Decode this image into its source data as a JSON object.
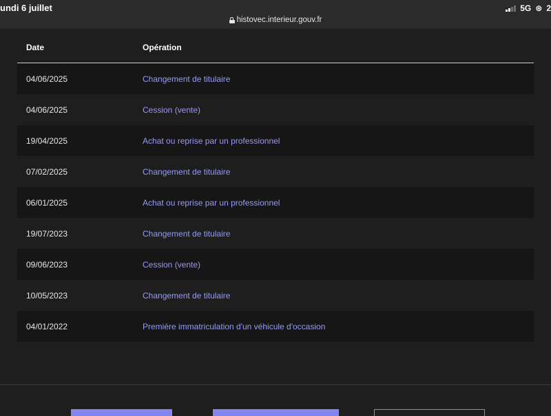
{
  "status_bar": {
    "time_text": "undi 6 juillet",
    "network": "5G",
    "right_trailing": "2"
  },
  "browser": {
    "url": "histovec.interieur.gouv.fr"
  },
  "table": {
    "headers": {
      "date": "Date",
      "operation": "Opération"
    },
    "rows": [
      {
        "date": "04/06/2025",
        "operation": "Changement de titulaire"
      },
      {
        "date": "04/06/2025",
        "operation": "Cession (vente)"
      },
      {
        "date": "19/04/2025",
        "operation": "Achat ou reprise par un professionnel"
      },
      {
        "date": "07/02/2025",
        "operation": "Changement de titulaire"
      },
      {
        "date": "06/01/2025",
        "operation": "Achat ou reprise par un professionnel"
      },
      {
        "date": "19/07/2023",
        "operation": "Changement de titulaire"
      },
      {
        "date": "09/06/2023",
        "operation": "Cession (vente)"
      },
      {
        "date": "10/05/2023",
        "operation": "Changement de titulaire"
      },
      {
        "date": "04/01/2022",
        "operation": "Première immatriculation d'un véhicule d'occasion"
      }
    ]
  },
  "colors": {
    "link": "#9a9af5",
    "button_primary": "#8585f0",
    "row_dark": "#161616",
    "background": "#1e1e1e"
  }
}
